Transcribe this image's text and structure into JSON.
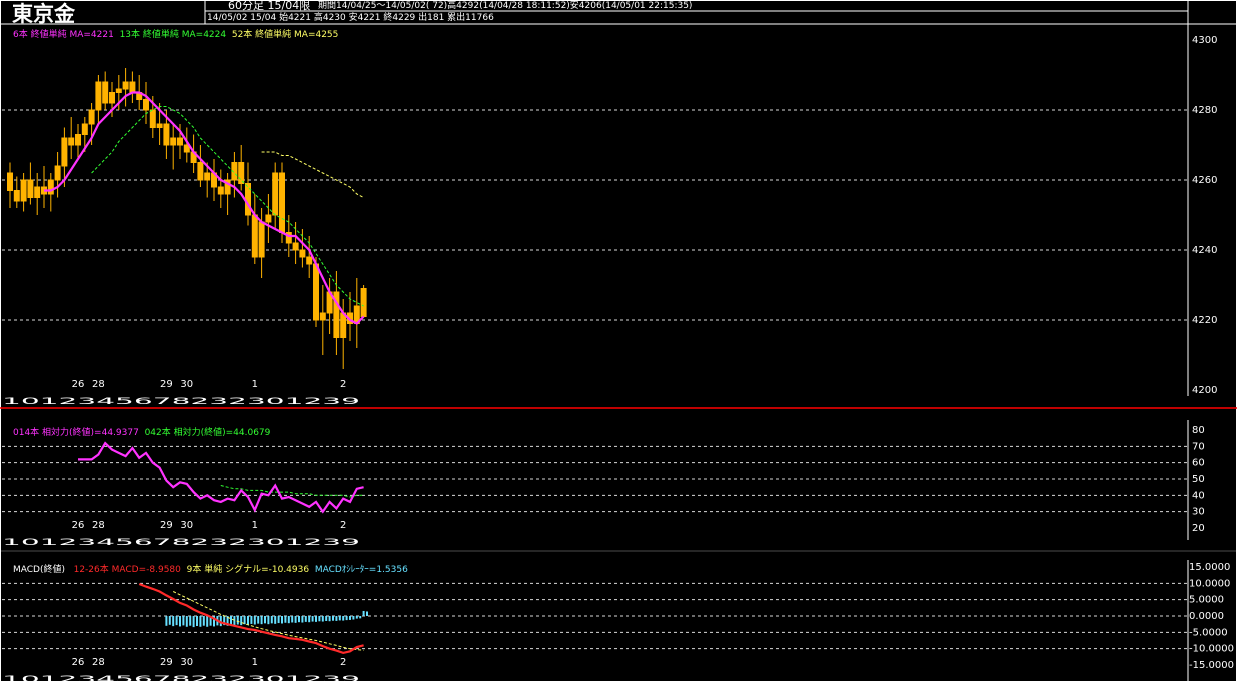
{
  "header": {
    "title": "東京金",
    "period_label": "60分足 15/04限",
    "range_text": "期間14/04/25～14/05/02( 72)高4292(14/04/28 18:11:52)安4206(14/05/01 22:15:35)",
    "ohlc_text": "14/05/02 15/04 始4221 高4230 安4221 終4229 出181 累出11766"
  },
  "colors": {
    "background": "#000000",
    "candle": "#ffb300",
    "ma6": "#ff33ff",
    "ma13": "#33ff33",
    "ma52": "#ffff66",
    "rsi14": "#ff33ff",
    "rsi42": "#33ff33",
    "macd": "#ff2a2a",
    "signal": "#ffff66",
    "oscillator": "#66e0ff",
    "grid": "#ffffff",
    "separator": "#ff0000"
  },
  "price_panel": {
    "legend": [
      {
        "text": "6本 終値単純 MA=4221",
        "color": "#ff33ff"
      },
      {
        "text": "13本 終値単純 MA=4224",
        "color": "#33ff33"
      },
      {
        "text": "52本 終値単純 MA=4255",
        "color": "#ffff66"
      }
    ]
  },
  "rsi_panel": {
    "legend": [
      {
        "text": "014本 相対力(終値)=44.9377",
        "color": "#ff33ff"
      },
      {
        "text": "042本 相対力(終値)=44.0679",
        "color": "#33ff33"
      }
    ]
  },
  "macd_panel": {
    "legend": [
      {
        "text": "MACD(終値)",
        "color": "#ffffff"
      },
      {
        "text": "12-26本 MACD=-8.9580",
        "color": "#ff2a2a"
      },
      {
        "text": "9本 単純 シグナル=-10.4936",
        "color": "#ffff66"
      },
      {
        "text": "MACDｵｼﾚｰﾀｰ=1.5356",
        "color": "#66e0ff"
      }
    ]
  },
  "date_labels": [
    {
      "index": 10,
      "label": "26"
    },
    {
      "index": 13,
      "label": "28"
    },
    {
      "index": 23,
      "label": "29"
    },
    {
      "index": 26,
      "label": "30"
    },
    {
      "index": 36,
      "label": "1"
    },
    {
      "index": 49,
      "label": "2"
    }
  ],
  "hour_tick_text": "1012345678232301239",
  "chart_data": [
    {
      "type": "candlestick",
      "title": "",
      "ylim": [
        4200,
        4300
      ],
      "y_ticks": [
        4200,
        4220,
        4240,
        4260,
        4280,
        4300
      ],
      "y_tick_labels": [
        "4200",
        "4220",
        "4240",
        "4260",
        "4280",
        "4300"
      ],
      "gridlines": [
        4220,
        4240,
        4260,
        4280
      ],
      "ohlc": [
        [
          4262,
          4265,
          4252,
          4257
        ],
        [
          4257,
          4261,
          4252,
          4254
        ],
        [
          4254,
          4262,
          4251,
          4260
        ],
        [
          4260,
          4265,
          4253,
          4255
        ],
        [
          4255,
          4262,
          4250,
          4258
        ],
        [
          4258,
          4264,
          4252,
          4256
        ],
        [
          4256,
          4262,
          4251,
          4260
        ],
        [
          4260,
          4268,
          4255,
          4264
        ],
        [
          4264,
          4275,
          4258,
          4272
        ],
        [
          4272,
          4278,
          4266,
          4270
        ],
        [
          4270,
          4276,
          4266,
          4273
        ],
        [
          4273,
          4278,
          4268,
          4276
        ],
        [
          4276,
          4282,
          4270,
          4280
        ],
        [
          4280,
          4290,
          4276,
          4288
        ],
        [
          4288,
          4291,
          4280,
          4282
        ],
        [
          4282,
          4288,
          4278,
          4285
        ],
        [
          4285,
          4290,
          4280,
          4286
        ],
        [
          4286,
          4292,
          4281,
          4288
        ],
        [
          4288,
          4291,
          4282,
          4285
        ],
        [
          4285,
          4290,
          4280,
          4283
        ],
        [
          4283,
          4288,
          4276,
          4280
        ],
        [
          4280,
          4284,
          4272,
          4275
        ],
        [
          4275,
          4282,
          4270,
          4276
        ],
        [
          4276,
          4280,
          4266,
          4270
        ],
        [
          4270,
          4276,
          4263,
          4272
        ],
        [
          4272,
          4276,
          4266,
          4270
        ],
        [
          4270,
          4275,
          4265,
          4268
        ],
        [
          4268,
          4273,
          4262,
          4265
        ],
        [
          4265,
          4270,
          4258,
          4260
        ],
        [
          4260,
          4265,
          4255,
          4262
        ],
        [
          4262,
          4266,
          4254,
          4258
        ],
        [
          4258,
          4263,
          4252,
          4256
        ],
        [
          4256,
          4262,
          4250,
          4260
        ],
        [
          4260,
          4268,
          4255,
          4265
        ],
        [
          4265,
          4270,
          4257,
          4259
        ],
        [
          4259,
          4265,
          4247,
          4250
        ],
        [
          4250,
          4256,
          4236,
          4238
        ],
        [
          4238,
          4252,
          4232,
          4248
        ],
        [
          4248,
          4256,
          4242,
          4250
        ],
        [
          4250,
          4265,
          4246,
          4262
        ],
        [
          4262,
          4265,
          4242,
          4245
        ],
        [
          4245,
          4250,
          4238,
          4242
        ],
        [
          4242,
          4248,
          4236,
          4240
        ],
        [
          4240,
          4246,
          4235,
          4238
        ],
        [
          4238,
          4244,
          4232,
          4236
        ],
        [
          4236,
          4238,
          4218,
          4220
        ],
        [
          4220,
          4230,
          4210,
          4222
        ],
        [
          4222,
          4232,
          4216,
          4228
        ],
        [
          4228,
          4234,
          4210,
          4215
        ],
        [
          4215,
          4226,
          4206,
          4222
        ],
        [
          4222,
          4228,
          4214,
          4219
        ],
        [
          4219,
          4232,
          4212,
          4224
        ],
        [
          4221,
          4230,
          4221,
          4229
        ]
      ],
      "series": [
        {
          "name": "6本 終値単純 MA=4221",
          "values": [
            null,
            null,
            null,
            null,
            null,
            4257,
            4257,
            4258,
            4260,
            4263,
            4266,
            4269,
            4272,
            4276,
            4278,
            4280,
            4282,
            4284,
            4285,
            4285,
            4284,
            4282,
            4280,
            4278,
            4276,
            4274,
            4271,
            4268,
            4266,
            4264,
            4262,
            4260,
            4259,
            4258,
            4256,
            4253,
            4250,
            4248,
            4247,
            4246,
            4245,
            4244,
            4244,
            4242,
            4240,
            4236,
            4232,
            4228,
            4225,
            4222,
            4220,
            4219,
            4221
          ]
        },
        {
          "name": "13本 終値単純 MA=4224",
          "values": [
            null,
            null,
            null,
            null,
            null,
            null,
            null,
            null,
            null,
            null,
            null,
            null,
            4262,
            4264,
            4266,
            4268,
            4271,
            4273,
            4275,
            4277,
            4279,
            4280,
            4281,
            4281,
            4280,
            4279,
            4277,
            4275,
            4272,
            4270,
            4268,
            4266,
            4264,
            4262,
            4260,
            4258,
            4256,
            4254,
            4252,
            4250,
            4249,
            4248,
            4246,
            4244,
            4242,
            4239,
            4236,
            4233,
            4230,
            4228,
            4226,
            4225,
            4224
          ]
        },
        {
          "name": "52本 終値単純 MA=4255",
          "values": [
            null,
            null,
            null,
            null,
            null,
            null,
            null,
            null,
            null,
            null,
            null,
            null,
            null,
            null,
            null,
            null,
            null,
            null,
            null,
            null,
            null,
            null,
            null,
            null,
            null,
            null,
            null,
            null,
            null,
            null,
            null,
            null,
            null,
            null,
            null,
            null,
            null,
            4268,
            4268,
            4268,
            4267,
            4267,
            4266,
            4265,
            4264,
            4263,
            4262,
            4261,
            4260,
            4259,
            4258,
            4256,
            4255
          ]
        }
      ]
    },
    {
      "type": "line",
      "title": "",
      "ylim": [
        20,
        80
      ],
      "y_ticks": [
        20,
        30,
        40,
        50,
        60,
        70,
        80
      ],
      "y_tick_labels": [
        "20",
        "30",
        "40",
        "50",
        "60",
        "70",
        "80"
      ],
      "gridlines": [
        30,
        40,
        50,
        60,
        70
      ],
      "series": [
        {
          "name": "014本 相対力(終値)=44.9377",
          "values": [
            null,
            null,
            null,
            null,
            null,
            null,
            null,
            null,
            null,
            null,
            62,
            62,
            62,
            65,
            72,
            68,
            66,
            64,
            69,
            63,
            66,
            60,
            57,
            49,
            45,
            48,
            47,
            42,
            38,
            40,
            37,
            36,
            38,
            37,
            43,
            39,
            31,
            41,
            40,
            46,
            38,
            39,
            37,
            35,
            33,
            36,
            30,
            36,
            32,
            38,
            36,
            44,
            45
          ]
        },
        {
          "name": "042本 相対力(終値)=44.0679",
          "values": [
            null,
            null,
            null,
            null,
            null,
            null,
            null,
            null,
            null,
            null,
            null,
            null,
            null,
            null,
            null,
            null,
            null,
            null,
            null,
            null,
            null,
            null,
            null,
            null,
            null,
            null,
            null,
            null,
            null,
            null,
            null,
            46,
            45,
            44,
            44,
            43,
            43,
            43,
            42,
            42,
            42,
            42,
            41,
            41,
            41,
            40,
            40,
            40,
            40,
            40,
            39,
            40,
            40
          ]
        }
      ]
    },
    {
      "type": "line",
      "title": "",
      "ylim": [
        -15,
        15
      ],
      "y_ticks": [
        15,
        10,
        5,
        0,
        -5,
        -10,
        -15
      ],
      "y_tick_labels": [
        "15.0000",
        "10.0000",
        "5.0000",
        "0.0000",
        "-5.0000",
        "-10.0000",
        "-15.0000"
      ],
      "gridlines": [
        10,
        5,
        0,
        -5,
        -10
      ],
      "series": [
        {
          "name": "12-26本 MACD=-8.9580",
          "values": [
            null,
            null,
            null,
            null,
            null,
            null,
            null,
            null,
            null,
            null,
            null,
            null,
            null,
            null,
            null,
            null,
            null,
            null,
            null,
            9.8,
            9.0,
            8.3,
            7.5,
            6.3,
            5.2,
            4.0,
            3.2,
            2.0,
            1.0,
            0.2,
            -0.8,
            -2.0,
            -2.5,
            -3.0,
            -3.5,
            -4.0,
            -4.3,
            -4.8,
            -5.3,
            -5.8,
            -6.2,
            -6.8,
            -7.0,
            -7.3,
            -7.8,
            -8.3,
            -9.2,
            -10.0,
            -10.6,
            -11.3,
            -10.8,
            -9.5,
            -8.96
          ]
        },
        {
          "name": "9本 単純 シグナル=-10.4936",
          "values": [
            null,
            null,
            null,
            null,
            null,
            null,
            null,
            null,
            null,
            null,
            null,
            null,
            null,
            null,
            null,
            null,
            null,
            null,
            null,
            null,
            null,
            null,
            null,
            null,
            7.5,
            6.5,
            5.5,
            4.5,
            3.5,
            2.5,
            1.5,
            0.5,
            -0.4,
            -1.3,
            -2.0,
            -2.7,
            -3.3,
            -3.9,
            -4.4,
            -4.9,
            -5.4,
            -5.9,
            -6.3,
            -6.7,
            -7.1,
            -7.5,
            -8.0,
            -8.5,
            -9.0,
            -9.6,
            -10.0,
            -10.3,
            -10.49
          ]
        },
        {
          "name": "MACDｵｼﾚｰﾀｰ=1.5356",
          "values": [
            null,
            null,
            null,
            null,
            null,
            null,
            null,
            null,
            null,
            null,
            null,
            null,
            null,
            null,
            null,
            null,
            null,
            null,
            null,
            null,
            null,
            null,
            null,
            -3.0,
            -3.1,
            -3.2,
            -3.3,
            -3.4,
            -3.3,
            -3.3,
            -3.2,
            -3.1,
            -3.0,
            -2.9,
            -2.8,
            -2.7,
            -2.6,
            -2.5,
            -2.5,
            -2.4,
            -2.3,
            -2.2,
            -2.1,
            -2.0,
            -1.9,
            -1.8,
            -1.7,
            -1.6,
            -1.5,
            -1.4,
            -1.2,
            -0.8,
            1.54
          ]
        }
      ]
    }
  ]
}
